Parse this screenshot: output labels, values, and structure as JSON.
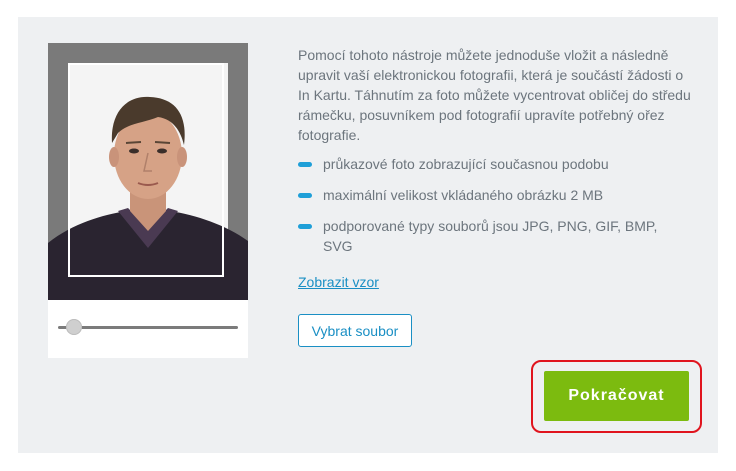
{
  "description": "Pomocí tohoto nástroje můžete jednoduše vložit a následně upravit vaší elektronickou fotografii, která je součástí žádosti o In Kartu. Táhnutím za foto můžete vycentrovat obličej do středu rámečku, posuvníkem pod fotografií upravíte potřebný ořez fotografie.",
  "bullets": [
    "průkazové foto zobrazující současnou podobu",
    "maximální velikost vkládaného obrázku 2 MB",
    "podporované typy souborů jsou JPG, PNG, GIF, BMP, SVG"
  ],
  "example_link": "Zobrazit vzor",
  "choose_file_label": "Vybrat soubor",
  "continue_label": "Pokračovat",
  "zoom_slider": {
    "value": 0.05
  },
  "colors": {
    "accent": "#1a8fc4",
    "bullet": "#1e9fd8",
    "continue": "#7cbb0f",
    "highlight": "#e0141e"
  }
}
